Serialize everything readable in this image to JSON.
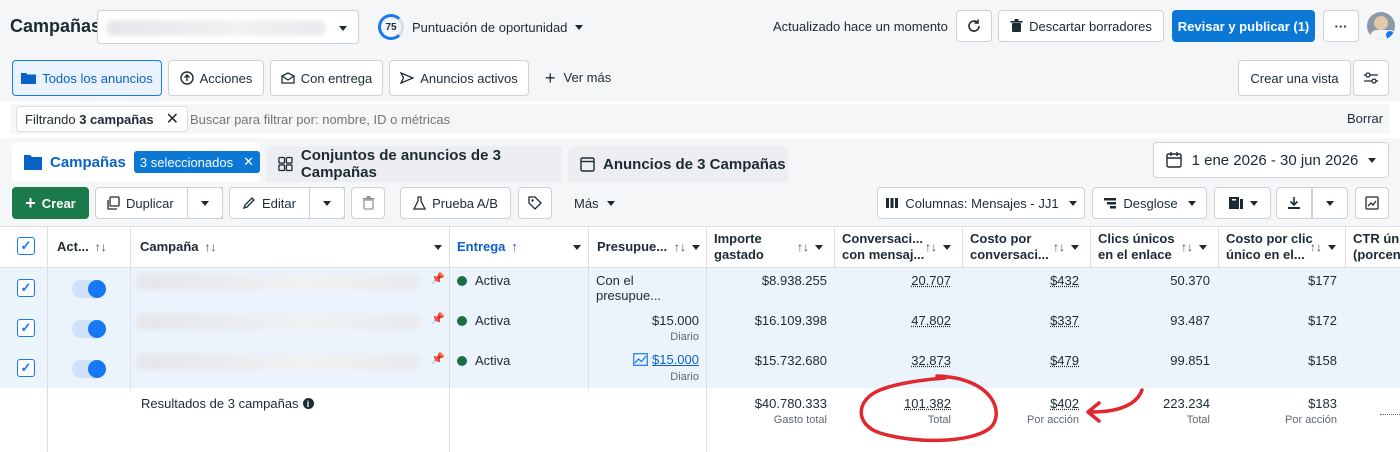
{
  "header": {
    "title": "Campañas",
    "opportunity_score": "75",
    "opportunity_label": "Puntuación de oportunidad",
    "updated": "Actualizado hace un momento",
    "discard": "Descartar borradores",
    "publish": "Revisar y publicar (1)",
    "more": "···"
  },
  "filters": {
    "pills": [
      "Todos los anuncios",
      "Acciones",
      "Con entrega",
      "Anuncios activos"
    ],
    "see_more": "Ver más",
    "create_view": "Crear una vista",
    "filtering_prefix": "Filtrando ",
    "filtering_bold": "3 campañas",
    "search_placeholder": "Buscar para filtrar por: nombre, ID o métricas",
    "clear": "Borrar"
  },
  "tabs": {
    "campaigns": "Campañas",
    "selected_badge": "3 seleccionados",
    "adsets": "Conjuntos de anuncios de 3 Campañas",
    "ads": "Anuncios de 3 Campañas",
    "date_range": "1 ene 2026 - 30 jun 2026"
  },
  "toolbar": {
    "create": "Crear",
    "duplicate": "Duplicar",
    "edit": "Editar",
    "ab_test": "Prueba A/B",
    "more": "Más",
    "columns": "Columnas: Mensajes - JJ1",
    "breakdown": "Desglose"
  },
  "table": {
    "headers": {
      "activation": "Act...",
      "campaign": "Campaña",
      "delivery": "Entrega",
      "budget": "Presupue...",
      "spent_1": "Importe",
      "spent_2": "gastado",
      "conv_1": "Conversaci...",
      "conv_2": "con mensaj...",
      "cost_1": "Costo por",
      "cost_2": "conversaci...",
      "clicks_1": "Clics únicos",
      "clicks_2": "en el enlace",
      "cpc_1": "Costo por clic",
      "cpc_2": "único en el...",
      "ctr_1": "CTR úni",
      "ctr_2": "(porcen"
    },
    "rows": [
      {
        "delivery": "Activa",
        "budget": "Con el presupue...",
        "budget_sub": "",
        "spent": "$8.938.255",
        "conversations": "20.707",
        "cost": "$432",
        "clicks": "50.370",
        "cpc": "$177"
      },
      {
        "delivery": "Activa",
        "budget": "$15.000",
        "budget_sub": "Diario",
        "spent": "$16.109.398",
        "conversations": "47.802",
        "cost": "$337",
        "clicks": "93.487",
        "cpc": "$172"
      },
      {
        "delivery": "Activa",
        "budget": "$15.000",
        "budget_sub": "Diario",
        "spent": "$15.732.680",
        "conversations": "32.873",
        "cost": "$479",
        "clicks": "99.851",
        "cpc": "$158"
      }
    ],
    "summary": {
      "label": "Resultados de 3 campañas",
      "spent": "$40.780.333",
      "spent_sub": "Gasto total",
      "conversations": "101.382",
      "conversations_sub": "Total",
      "cost": "$402",
      "cost_sub": "Por acción",
      "clicks": "223.234",
      "clicks_sub": "Total",
      "cpc": "$183",
      "cpc_sub": "Por acción"
    }
  },
  "colors": {
    "primary": "#1877f2",
    "create_green": "#1a7a4a",
    "annotation_red": "#e0282e",
    "row_selected": "#ebf3fc",
    "active_dot": "#1f6e43"
  }
}
